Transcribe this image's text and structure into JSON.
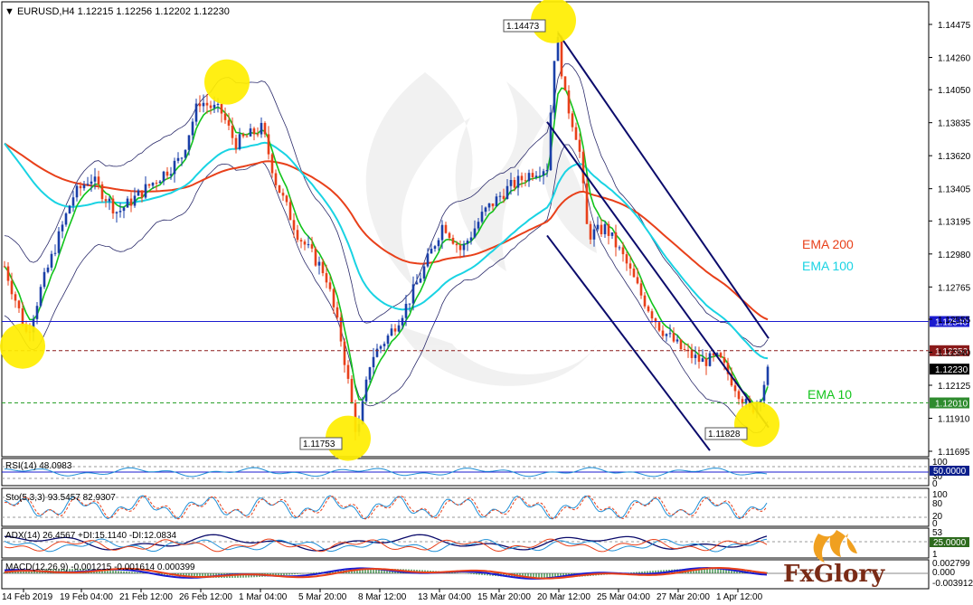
{
  "header": {
    "symbol": "EURUSD,H4",
    "ohlc": "1.12215 1.12256 1.12202 1.12230"
  },
  "chart_data": {
    "type": "candlestick",
    "ylim": [
      1.11695,
      1.14475
    ],
    "y_ticks": [
      "1.14475",
      "1.14260",
      "1.14050",
      "1.13835",
      "1.13620",
      "1.13405",
      "1.13195",
      "1.12980",
      "1.12765",
      "1.12555",
      "1.12340",
      "1.12125",
      "1.11910",
      "1.11695"
    ],
    "x_ticks": [
      "14 Feb 2019",
      "19 Feb 04:00",
      "21 Feb 12:00",
      "26 Feb 12:00",
      "1 Mar 04:00",
      "5 Mar 20:00",
      "8 Mar 12:00",
      "13 Mar 04:00",
      "15 Mar 20:00",
      "20 Mar 12:00",
      "25 Mar 04:00",
      "27 Mar 20:00",
      "1 Apr 12:00"
    ],
    "price_tags": {
      "blue_line": "1.12540",
      "resistance": "1.12350",
      "current": "1.12230",
      "support": "1.12010"
    },
    "annotations": {
      "high": "1.14473",
      "low1": "1.11753",
      "low2": "1.11828"
    },
    "ema_labels": {
      "ema200": "EMA 200",
      "ema100": "EMA 100",
      "ema10": "EMA 10"
    },
    "colors": {
      "ema200": "#e8401a",
      "ema100": "#19d3e3",
      "ema10": "#12c41b",
      "bull": "#1a3fa8",
      "bear": "#e8401a",
      "bands": "#2a2a6a",
      "channel": "#0b0b6b"
    },
    "indicators": {
      "rsi": {
        "label": "RSI(14) 48.0983",
        "ticks": [
          "100",
          "70",
          "30",
          "0"
        ],
        "tag": "50.0000"
      },
      "stoch": {
        "label": "Sto(5,3,3) 93.5457 82.9307",
        "ticks": [
          "100",
          "80",
          "20",
          "0"
        ]
      },
      "adx": {
        "label": "ADX(14) 26.4567 +DI:15.1140 -DI:12.0834",
        "ticks": [
          "53",
          "1"
        ],
        "tag": "25.0000"
      },
      "macd": {
        "label": "MACD(12,26,9) -0.001215 -0.001614 0.000399",
        "ticks": [
          "0.002799",
          "0.000",
          "-0.003912"
        ]
      }
    }
  },
  "brand": {
    "logo": "FxGlory"
  }
}
